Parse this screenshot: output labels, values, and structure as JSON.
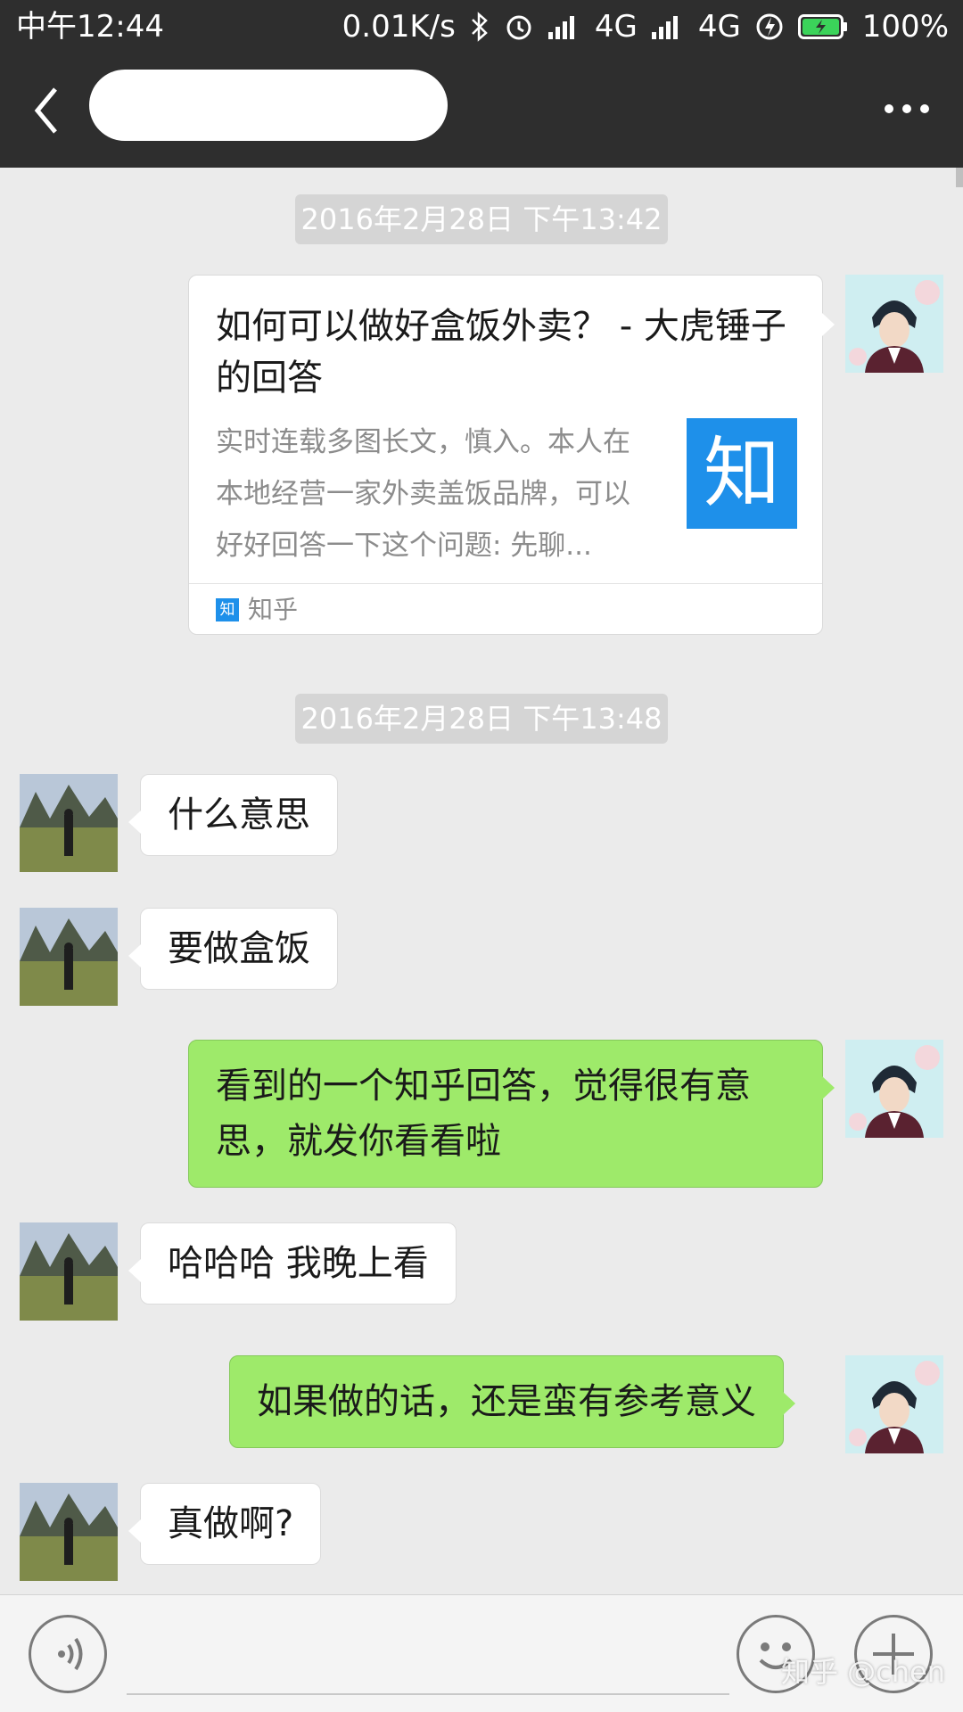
{
  "status_bar": {
    "time": "中午12:44",
    "network_speed": "0.01K/s",
    "signal1_label": "4G",
    "signal2_label": "4G",
    "battery": "100%",
    "icons": [
      "bluetooth-icon",
      "alarm-icon",
      "signal-icon",
      "signal-icon",
      "charging-icon",
      "battery-icon"
    ]
  },
  "header": {
    "back_icon": "chevron-left-icon",
    "more_icon": "more-dots-icon"
  },
  "messages": {
    "ts1": "2016年2月28日 下午13:42",
    "link_card": {
      "title": "如何可以做好盒饭外卖？ - 大虎锤子 的回答",
      "description": "实时连载多图长文，慎入。本人在本地经营一家外卖盖饭品牌，可以好好回答一下这个问题: 先聊...",
      "thumb_text": "知",
      "source_icon_text": "知",
      "source": "知乎"
    },
    "ts2": "2016年2月28日 下午13:48",
    "m1": "什么意思",
    "m2": "要做盒饭",
    "m3": "看到的一个知乎回答，觉得很有意思，就发你看看啦",
    "m4": "哈哈哈 我晚上看",
    "m5": "如果做的话，还是蛮有参考意义",
    "m6": "真做啊?"
  },
  "input_bar": {
    "voice_icon": "voice-icon",
    "emoji_icon": "emoji-icon",
    "add_icon": "plus-icon",
    "placeholder": ""
  },
  "watermark": "知乎 @chen",
  "colors": {
    "header_bg": "#2e2e2e",
    "chat_bg": "#ebebeb",
    "out_bubble": "#9eea6a",
    "in_bubble": "#ffffff",
    "zhihu_blue": "#1e90ea"
  }
}
